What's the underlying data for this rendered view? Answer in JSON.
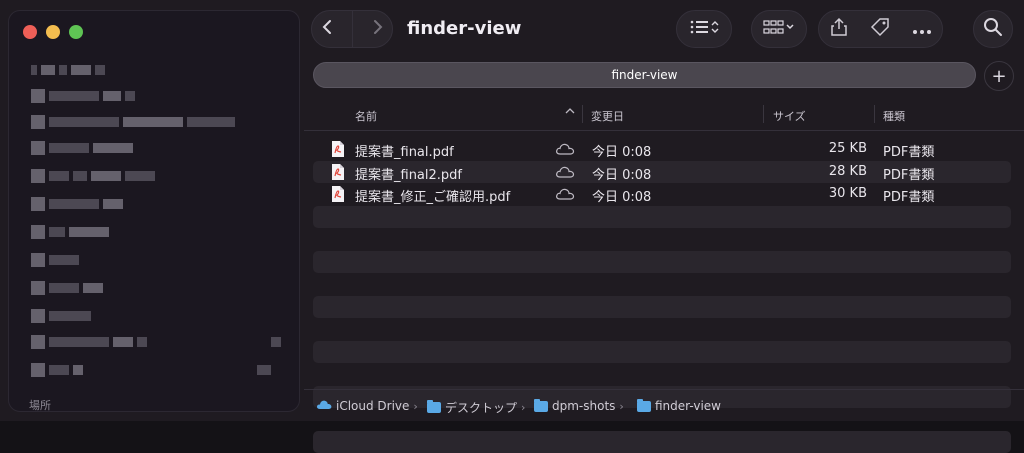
{
  "window": {
    "title": "finder-view"
  },
  "sidebar": {
    "places_label": "場所"
  },
  "toolbar": {
    "back_icon": "chevron-left-icon",
    "forward_icon": "chevron-right-icon",
    "view_icon": "list-view-icon",
    "group_icon": "grid-group-icon",
    "share_icon": "share-icon",
    "tag_icon": "tag-icon",
    "more_icon": "ellipsis-icon",
    "search_icon": "search-icon"
  },
  "path_bar": {
    "label": "finder-view",
    "add_label": "+"
  },
  "columns": {
    "name": "名前",
    "modified": "変更日",
    "size": "サイズ",
    "kind": "種類"
  },
  "files": [
    {
      "name": "提案書_final.pdf",
      "date": "今日 0:08",
      "size": "25 KB",
      "kind": "PDF書類"
    },
    {
      "name": "提案書_final2.pdf",
      "date": "今日 0:08",
      "size": "28 KB",
      "kind": "PDF書類"
    },
    {
      "name": "提案書_修正_ご確認用.pdf",
      "date": "今日 0:08",
      "size": "30 KB",
      "kind": "PDF書類"
    }
  ],
  "breadcrumb": {
    "items": [
      "iCloud Drive",
      "デスクトップ",
      "dpm-shots",
      "finder-view"
    ]
  },
  "colors": {
    "accent": "#5aa9e6",
    "pdf_red": "#e0453a"
  }
}
